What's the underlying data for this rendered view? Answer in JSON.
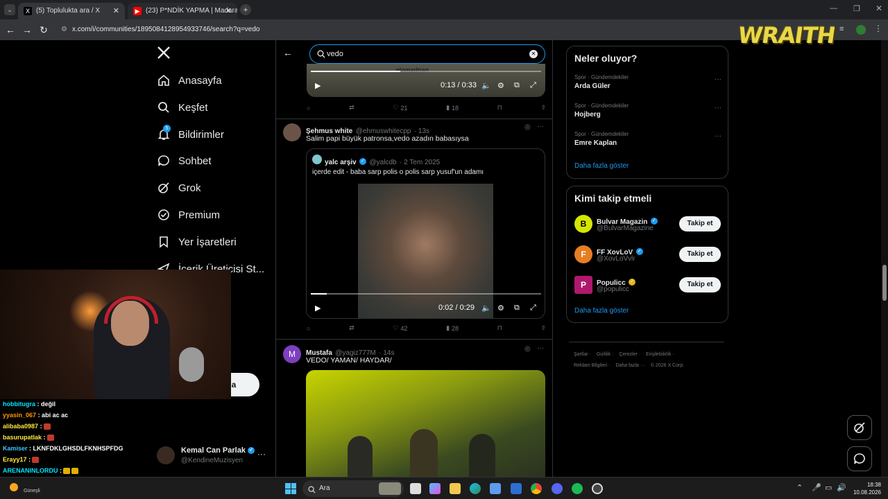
{
  "browser": {
    "tabs": [
      {
        "title": "(5) Toplulukta ara / X",
        "active": true
      },
      {
        "title": "(23) P*NDİK YAPMA | Madara O",
        "active": false
      }
    ],
    "url": "x.com/i/communities/1895084128954933746/search?q=vedo"
  },
  "overlay": {
    "logo_text": "WRAITH"
  },
  "nav": {
    "items": [
      {
        "label": "Anasayfa",
        "icon": "home-icon"
      },
      {
        "label": "Keşfet",
        "icon": "search-icon"
      },
      {
        "label": "Bildirimler",
        "icon": "bell-icon",
        "badge": "5"
      },
      {
        "label": "Sohbet",
        "icon": "chat-icon"
      },
      {
        "label": "Grok",
        "icon": "grok-icon"
      },
      {
        "label": "Premium",
        "icon": "premium-icon"
      },
      {
        "label": "Yer İşaretleri",
        "icon": "bookmark-icon"
      },
      {
        "label": "İçerik Üreticisi St...",
        "icon": "creator-icon"
      }
    ],
    "post_button_fragment": "a",
    "account": {
      "name": "Kemal Can Parlak",
      "handle": "@KendineMuzisyen"
    }
  },
  "search": {
    "value": "vedo"
  },
  "posts": [
    {
      "video": {
        "caption": "atomadnan",
        "time": "0:13 / 0:33"
      },
      "stats": {
        "replies": "",
        "reposts": "",
        "likes": "21",
        "views": "18"
      }
    },
    {
      "name": "Şehmus white",
      "handle": "@ehmuswhitecpp",
      "time": "· 13s",
      "text": "Salim papi büyük patronsa,vedo azadın babasıysa",
      "quote": {
        "name": "yalc arşiv",
        "handle": "@yalcdb",
        "date": "· 2 Tem 2025",
        "text": "içerde edit - baba sarp polis o polis sarp yusuf'un adamı",
        "time": "0:02 / 0:29"
      },
      "stats": {
        "replies": "",
        "reposts": "",
        "likes": "42",
        "views": "28"
      }
    },
    {
      "name": "Mustafa",
      "handle": "@yagiz777M",
      "time": "· 14s",
      "avatar_letter": "M",
      "text": "VEDO/ YAMAN/ HAYDAR/"
    }
  ],
  "trends": {
    "title": "Neler oluyor?",
    "items": [
      {
        "category": "Spor · Gündemdekiler",
        "name": "Arda Güler"
      },
      {
        "category": "Spor · Gündemdekiler",
        "name": "Hojberg"
      },
      {
        "category": "Spor · Gündemdekiler",
        "name": "Emre Kaplan"
      }
    ],
    "more": "Daha fazla göster"
  },
  "who_to_follow": {
    "title": "Kimi takip etmeli",
    "items": [
      {
        "name": "Bulvar Magazin",
        "handle": "@BulvarMagazine",
        "button": "Takip et",
        "color": "#d4e600",
        "letter": "B"
      },
      {
        "name": "FF XovLoV",
        "handle": "@XovLoVvlr",
        "button": "Takip et",
        "color": "#e67e22",
        "letter": "F"
      },
      {
        "name": "Populicc",
        "handle": "@populicc",
        "button": "Takip et",
        "color": "#b0186e",
        "letter": "P"
      }
    ],
    "more": "Daha fazla göster"
  },
  "footer": {
    "line1": [
      "Şartlar",
      "Gizlilik",
      "Çerezler",
      "Erişilebilirlik"
    ],
    "line2": [
      "Reklam Bilgileri",
      "Daha fazla ···",
      "© 2026 X Corp."
    ]
  },
  "chat": [
    {
      "user": "hobbitugra",
      "color": "#00e5ff",
      "msg": ": değil"
    },
    {
      "user": "yyasin_067",
      "color": "#ff9800",
      "msg": ": abi ac ac"
    },
    {
      "user": "alibaba0987",
      "color": "#ffeb3b",
      "msg": ":"
    },
    {
      "user": "basurupatlak",
      "color": "#ffeb3b",
      "msg": ":"
    },
    {
      "user": "Kamiser",
      "color": "#40c4ff",
      "msg": ": LKNFDKLGHSDLFKNHSPFDG"
    },
    {
      "user": "Erayy17",
      "color": "#ffeb3b",
      "msg": ":"
    },
    {
      "user": "ARENANINLORDU",
      "color": "#00e5ff",
      "msg": ":"
    },
    {
      "user": "GhebesbTurtle",
      "color": "#ff9800",
      "msg": ":"
    }
  ],
  "taskbar": {
    "search": "Ara",
    "weather": "Güneşli",
    "time": "18:38",
    "date": "10.08.2026"
  }
}
